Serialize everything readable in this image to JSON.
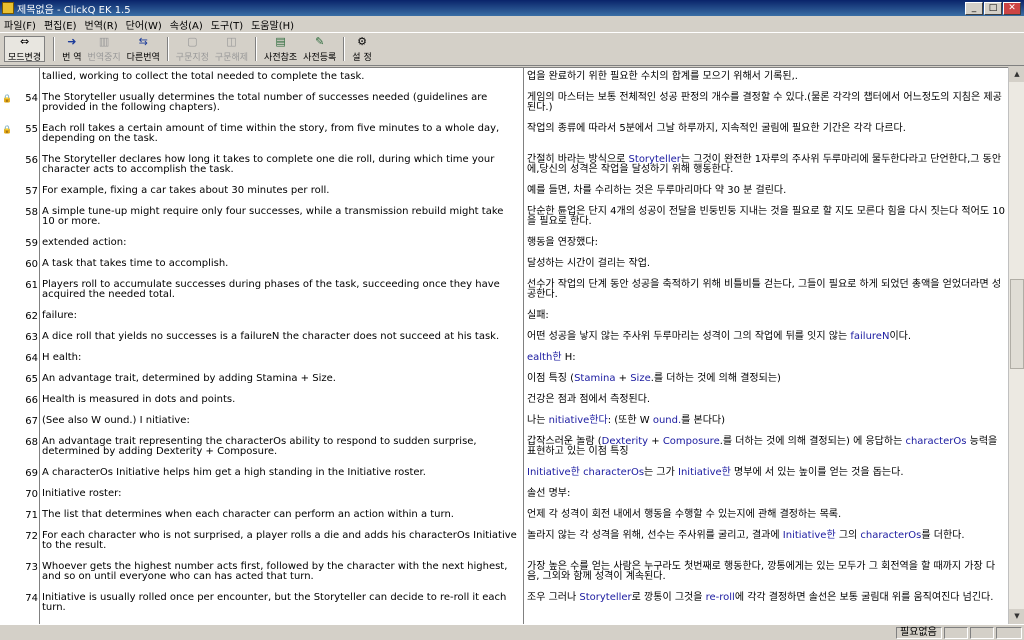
{
  "window": {
    "title": "제목없음 - ClickQ EK 1.5"
  },
  "menu": [
    "파일(F)",
    "편집(E)",
    "번역(R)",
    "단어(W)",
    "속성(A)",
    "도구(T)",
    "도움말(H)"
  ],
  "toolbar": {
    "mode": "모드변경",
    "translate": "번 역",
    "stop": "번역중지",
    "other": "다른번역",
    "phrase_set": "구문지정",
    "phrase_clear": "구문해제",
    "dict_ref": "사전참조",
    "dict_reg": "사전등록",
    "settings": "설 정"
  },
  "rows": [
    {
      "num": "",
      "lock": false,
      "src": "tallied, working to collect the total needed to complete the task.",
      "tgt": "업을 완료하기 위한 필요한 수치의 합계를 모으기 위해서 기록된,."
    },
    {
      "num": "54",
      "lock": true,
      "src": "The Storyteller usually determines the total number of successes needed (guidelines are provided in the following chapters).",
      "tgt": "게임의 마스터는 보통 전체적인 성공 판정의 개수를 결정할 수 있다.(물론 각각의 챕터에서 어느정도의 지침은 제공된다.)"
    },
    {
      "num": "55",
      "lock": true,
      "src": "Each roll takes a certain amount of time within the story, from five minutes to a whole day, depending on the task.",
      "tgt": "작업의 종류에 따라서 5분에서 그날 하루까지, 지속적인 굴림에 필요한 기간은 각각 다르다."
    },
    {
      "num": "56",
      "lock": false,
      "src": "The Storyteller declares how long it takes to complete one die roll, during which time your character acts to accomplish the task.",
      "tgt_html": "간절히 바라는 방식으로 <span class=\"hl\">Storyteller</span>는 그것이 완전한 1자루의 주사위 두루마리에 물두한다라고 단언한다,그 동안에,당신의 성격은 작업을 달성하기 위해 행동한다."
    },
    {
      "num": "57",
      "lock": false,
      "src": "For example, fixing a car takes about 30 minutes per roll.",
      "tgt": "예를 들면, 차를 수리하는 것은 두루마리마다 약 30 분 걸린다."
    },
    {
      "num": "58",
      "lock": false,
      "src": "A simple tune-up might require only four successes, while a transmission rebuild might take 10 or more.",
      "tgt": "단순한 튠업은 단지 4개의 성공이 전달을 빈둥빈둥 지내는 것을 필요로 할 지도 모른다 힘을 다시 짓는다 적어도 10을 필요로 한다."
    },
    {
      "num": "59",
      "lock": false,
      "src": "extended action:",
      "tgt": "행동을 연장했다:"
    },
    {
      "num": "60",
      "lock": false,
      "src": "A task that takes time to accomplish.",
      "tgt": "달성하는 시간이 걸리는 작업."
    },
    {
      "num": "61",
      "lock": false,
      "src": "Players roll to accumulate successes during phases of the task, succeeding once they have acquired the needed total.",
      "tgt": "선수가 작업의 단계 동안 성공을 축적하기 위해 비틀비틀 걷는다, 그들이 필요로 하게 되었던 총액을 얻었더라면 성공한다."
    },
    {
      "num": "62",
      "lock": false,
      "src": "failure:",
      "tgt": "실패:"
    },
    {
      "num": "63",
      "lock": false,
      "src": "A dice roll that yields no successes is a failureN the character does not succeed at his task.",
      "tgt_html": "어떤 성공을 낳지 않는 주사위 두루마리는 성격이 그의 작업에 뒤를 잇지 않는 <span class=\"hl\">failureN</span>이다."
    },
    {
      "num": "64",
      "lock": false,
      "src": "H ealth:",
      "tgt_html": "<span class=\"hl\">ealth한</span> H:"
    },
    {
      "num": "65",
      "lock": false,
      "src": "An advantage trait, determined by adding Stamina + Size.",
      "tgt_html": "이점 특징 (<span class=\"hl\">Stamina</span> + <span class=\"hl\">Size</span>.를 더하는 것에 의해 결정되는)"
    },
    {
      "num": "66",
      "lock": false,
      "src": "Health is measured in dots and points.",
      "tgt": "건강은 점과 점에서 측정된다."
    },
    {
      "num": "67",
      "lock": false,
      "src": "(See also W ound.) I nitiative:",
      "tgt_html": "나는 <span class=\"hl\">nitiative한다</span>: (또한 W <span class=\"hl\">ound.</span>를 본다다)"
    },
    {
      "num": "68",
      "lock": false,
      "src": "An advantage trait representing the characterOs ability to respond to sudden surprise, determined by adding Dexterity + Composure.",
      "tgt_html": "갑작스러운 놀람 (<span class=\"hl\">Dexterity</span> + <span class=\"hl\">Composure</span>.를 더하는 것에 의해 결정되는) 에 응답하는 <span class=\"hl\">characterOs</span> 능력을 표현하고 있는 이점 특징"
    },
    {
      "num": "69",
      "lock": false,
      "src": "A characterOs Initiative helps him get a high standing in the Initiative roster.",
      "tgt_html": "<span class=\"hl\">Initiative한</span> <span class=\"hl\">characterOs</span>는 그가 <span class=\"hl\">Initiative한</span> 명부에 서 있는 높이를 얻는 것을 돕는다."
    },
    {
      "num": "70",
      "lock": false,
      "src": "Initiative roster:",
      "tgt": "솔선 명부:"
    },
    {
      "num": "71",
      "lock": false,
      "src": "The list that determines when each character can perform an action within a turn.",
      "tgt": "언제 각 성격이 회전 내에서 행동을 수행할 수 있는지에 관해 결정하는 목록."
    },
    {
      "num": "72",
      "lock": false,
      "src": "For each character who is not surprised, a player rolls a die and adds his characterOs Initiative to the result.",
      "tgt_html": "놀라지 않는 각 성격을 위해, 선수는 주사위를 굴리고, 결과에 <span class=\"hl\">Initiative한</span> 그의 <span class=\"hl\">characterOs</span>를 더한다."
    },
    {
      "num": "73",
      "lock": false,
      "src": "Whoever gets the highest number acts first, followed by the character with the next highest, and so on until everyone who can has acted that turn.",
      "tgt": "가장 높은 수를 얻는 사람은 누구라도 첫번째로 행동한다, 깡통에게는 있는 모두가 그 회전역을 할 때까지 가장 다음, 그외와 함께 성격이 계속된다."
    },
    {
      "num": "74",
      "lock": false,
      "src": "Initiative is usually rolled once per encounter, but the Storyteller can decide to re-roll it each turn.",
      "tgt_html": "조우 그러나 <span class=\"hl\">Storyteller</span>로 깡통이 그것을 <span class=\"hl\">re-roll</span>에 각각 결정하면 솔선은 보통 굴림대 위를 움직여진다 넘긴다."
    }
  ],
  "status": {
    "text": "필요없음"
  }
}
